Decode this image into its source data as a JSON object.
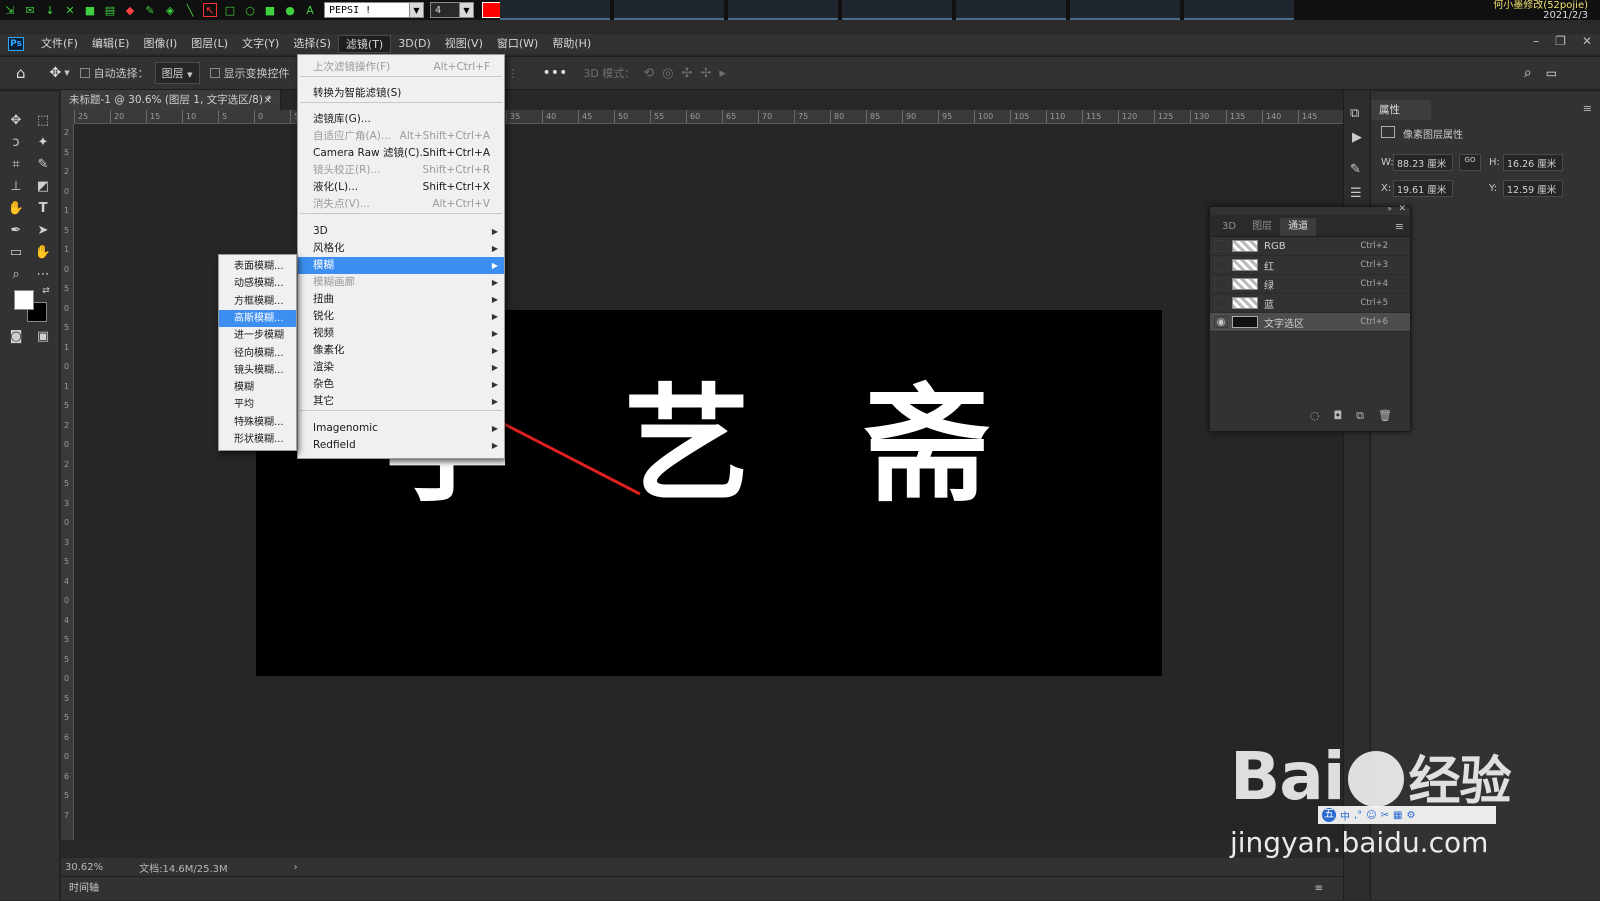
{
  "annotation_toolbar": {
    "font_value": "PEPSI !",
    "size_value": "4",
    "color": "#ff0000",
    "clock_line1": "何小墨修改(52pojie)",
    "clock_line2": "2021/2/3"
  },
  "menubar": {
    "items": [
      "文件(F)",
      "编辑(E)",
      "图像(I)",
      "图层(L)",
      "文字(Y)",
      "选择(S)",
      "滤镜(T)",
      "3D(D)",
      "视图(V)",
      "窗口(W)",
      "帮助(H)"
    ],
    "active_index": 6
  },
  "options_bar": {
    "auto_select_label": "自动选择：",
    "auto_select_value": "图层",
    "show_transform_label": "显示变换控件",
    "mode_3d_label": "3D 模式："
  },
  "document": {
    "tab_title": "未标题-1 @ 30.6% (图层 1, 文字选区/8) *",
    "canvas_text": [
      "学",
      "艺",
      "斋"
    ],
    "canvas_color": "#000000",
    "text_color": "#ffffff"
  },
  "rulers": {
    "h_labels": [
      "25",
      "20",
      "15",
      "10",
      "5",
      "0",
      "5",
      "10",
      "15",
      "20",
      "25",
      "30",
      "35",
      "40",
      "45",
      "50",
      "55",
      "60",
      "65",
      "70",
      "75",
      "80",
      "85",
      "90",
      "95",
      "100",
      "105",
      "110",
      "115",
      "120",
      "125",
      "130",
      "135",
      "140",
      "145"
    ],
    "v_labels": [
      "2",
      "5",
      "2",
      "0",
      "1",
      "5",
      "1",
      "0",
      "5",
      "0",
      "5",
      "1",
      "0",
      "1",
      "5",
      "2",
      "0",
      "2",
      "5",
      "3",
      "0",
      "3",
      "5",
      "4",
      "0",
      "4",
      "5",
      "5",
      "0",
      "5",
      "5",
      "6",
      "0",
      "6",
      "5",
      "7"
    ]
  },
  "status_bar": {
    "zoom": "30.62%",
    "doc_info": "文档:14.6M/25.3M",
    "arrow": "›"
  },
  "timeline_label": "时间轴",
  "properties_panel": {
    "tab_label": "属性",
    "section_label": "像素图层属性",
    "w_label": "W:",
    "w_value": "88.23 厘米",
    "h_label": "H:",
    "h_value": "16.26 厘米",
    "x_label": "X:",
    "x_value": "19.61 厘米",
    "y_label": "Y:",
    "y_value": "12.59 厘米",
    "link_label": "GO"
  },
  "channels_panel": {
    "tabs": [
      "3D",
      "图层",
      "通道"
    ],
    "active_tab": 2,
    "rows": [
      {
        "name": "RGB",
        "shortcut": "Ctrl+2"
      },
      {
        "name": "红",
        "shortcut": "Ctrl+3"
      },
      {
        "name": "绿",
        "shortcut": "Ctrl+4"
      },
      {
        "name": "蓝",
        "shortcut": "Ctrl+5"
      },
      {
        "name": "文字选区",
        "shortcut": "Ctrl+6"
      }
    ],
    "selected_index": 4
  },
  "filter_menu": {
    "items": [
      {
        "label": "上次滤镜操作(F)",
        "shortcut": "Alt+Ctrl+F",
        "disabled": true
      },
      {
        "label": "转换为智能滤镜(S)",
        "shortcut": "",
        "disabled": false
      },
      {
        "label": "滤镜库(G)...",
        "shortcut": "",
        "disabled": false
      },
      {
        "label": "自适应广角(A)...",
        "shortcut": "Alt+Shift+Ctrl+A",
        "disabled": true
      },
      {
        "label": "Camera Raw 滤镜(C)...",
        "shortcut": "Shift+Ctrl+A",
        "disabled": false
      },
      {
        "label": "镜头校正(R)...",
        "shortcut": "Shift+Ctrl+R",
        "disabled": true
      },
      {
        "label": "液化(L)...",
        "shortcut": "Shift+Ctrl+X",
        "disabled": false
      },
      {
        "label": "消失点(V)...",
        "shortcut": "Alt+Ctrl+V",
        "disabled": true
      },
      {
        "label": "3D",
        "submenu": true
      },
      {
        "label": "风格化",
        "submenu": true
      },
      {
        "label": "模糊",
        "submenu": true,
        "highlighted": true
      },
      {
        "label": "模糊画廊",
        "submenu": true,
        "disabled": true
      },
      {
        "label": "扭曲",
        "submenu": true
      },
      {
        "label": "锐化",
        "submenu": true
      },
      {
        "label": "视频",
        "submenu": true
      },
      {
        "label": "像素化",
        "submenu": true
      },
      {
        "label": "渲染",
        "submenu": true
      },
      {
        "label": "杂色",
        "submenu": true
      },
      {
        "label": "其它",
        "submenu": true
      },
      {
        "label": "Imagenomic",
        "submenu": true
      },
      {
        "label": "Redfield",
        "submenu": true
      }
    ]
  },
  "blur_submenu": {
    "items": [
      "表面模糊...",
      "动感模糊...",
      "方框模糊...",
      "高斯模糊...",
      "进一步模糊",
      "径向模糊...",
      "镜头模糊...",
      "模糊",
      "平均",
      "特殊模糊...",
      "形状模糊..."
    ],
    "highlighted_index": 3
  },
  "annotation_arrow_color": "#e02020",
  "watermark": {
    "brand": "Bai",
    "brand_cn": "经验",
    "url": "jingyan.baidu.com"
  }
}
